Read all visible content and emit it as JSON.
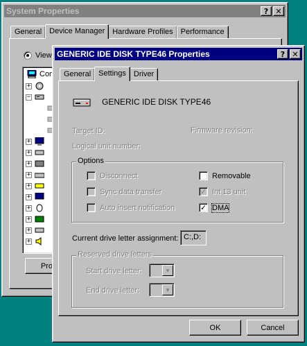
{
  "background_color": "#008080",
  "back_window": {
    "title": "System Properties",
    "title_buttons": [
      "?",
      "✕"
    ],
    "tabs": [
      {
        "label": "General",
        "active": false
      },
      {
        "label": "Device Manager",
        "active": true
      },
      {
        "label": "Hardware Profiles",
        "active": false
      },
      {
        "label": "Performance",
        "active": false
      }
    ],
    "view_radio_label": "View",
    "tree_first_item": "Com",
    "properties_button_label": "Prope"
  },
  "dialog": {
    "title": "GENERIC IDE  DISK TYPE46 Properties",
    "title_buttons": [
      "?",
      "✕"
    ],
    "tabs": [
      {
        "label": "General",
        "active": false
      },
      {
        "label": "Settings",
        "active": true
      },
      {
        "label": "Driver",
        "active": false
      }
    ],
    "device_name": "GENERIC IDE  DISK TYPE46",
    "target_id_label": "Target ID:",
    "firmware_label": "Firmware revision:",
    "lun_label": "Logical unit number:",
    "options": {
      "legend": "Options",
      "disconnect": {
        "label": "Disconnect",
        "checked": false,
        "enabled": false
      },
      "sync_transfer": {
        "label": "Sync data transfer",
        "checked": false,
        "enabled": false
      },
      "auto_insert": {
        "label": "Auto insert notification",
        "checked": false,
        "enabled": false
      },
      "removable": {
        "label": "Removable",
        "checked": false,
        "enabled": true
      },
      "int13": {
        "label": "Int 13 unit",
        "checked": true,
        "enabled": false
      },
      "dma": {
        "label": "DMA",
        "checked": true,
        "enabled": true
      }
    },
    "current_drive_label": "Current drive letter assignment:",
    "current_drive_value": "C:,D:",
    "reserved": {
      "legend": "Reserved drive letters",
      "start_label": "Start drive letter:",
      "end_label": "End drive letter:"
    },
    "ok_label": "OK",
    "cancel_label": "Cancel"
  }
}
